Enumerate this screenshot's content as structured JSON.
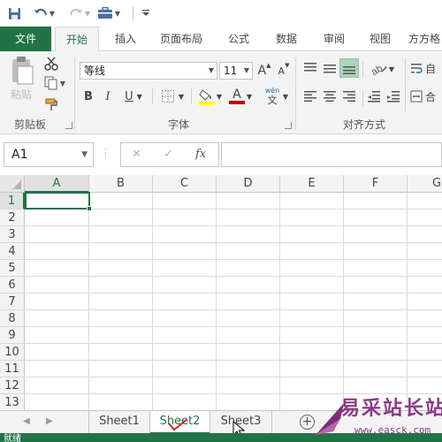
{
  "quick_access": {
    "save_icon": "save-icon",
    "undo_icon": "undo-icon",
    "redo_icon": "redo-icon",
    "briefcase_icon": "briefcase-icon",
    "customize_icon": "customize-qat-icon"
  },
  "ribbon_tabs": {
    "file": "文件",
    "home": "开始",
    "insert": "插入",
    "page_layout": "页面布局",
    "formulas": "公式",
    "data": "数据",
    "review": "审阅",
    "view": "视图",
    "extra": "方方格"
  },
  "clipboard": {
    "paste_label": "粘贴",
    "group_label": "剪贴板"
  },
  "font": {
    "family": "等线",
    "size": "11",
    "bold": "B",
    "italic": "I",
    "underline": "U",
    "grow": "A",
    "shrink": "A",
    "font_color_letter": "A",
    "phonetic_top": "wén",
    "phonetic_bottom": "文",
    "group_label": "字体",
    "fill_color": "#ffff00",
    "font_color": "#c00000"
  },
  "alignment": {
    "group_label": "对齐方式",
    "wrap_partial": "自",
    "merge_partial": "合"
  },
  "formula_bar": {
    "name_box": "A1",
    "fx": "fx",
    "cancel": "✕",
    "enter": "✓",
    "value": ""
  },
  "grid": {
    "columns": [
      "A",
      "B",
      "C",
      "D",
      "E",
      "F",
      "G"
    ],
    "rows": [
      "1",
      "2",
      "3",
      "4",
      "5",
      "6",
      "7",
      "8",
      "9",
      "10",
      "11",
      "12",
      "13"
    ],
    "active_cell": "A1"
  },
  "sheets": {
    "tabs": [
      "Sheet1",
      "Sheet2",
      "Sheet3"
    ],
    "active": "Sheet2",
    "nav_prev": "◀",
    "nav_next": "▶",
    "add": "+"
  },
  "status": {
    "text": "就绪"
  },
  "watermark": {
    "text": "易采站长站",
    "url": "www.easck.com"
  },
  "colors": {
    "accent": "#217346",
    "watermark": "#8b3a86"
  }
}
